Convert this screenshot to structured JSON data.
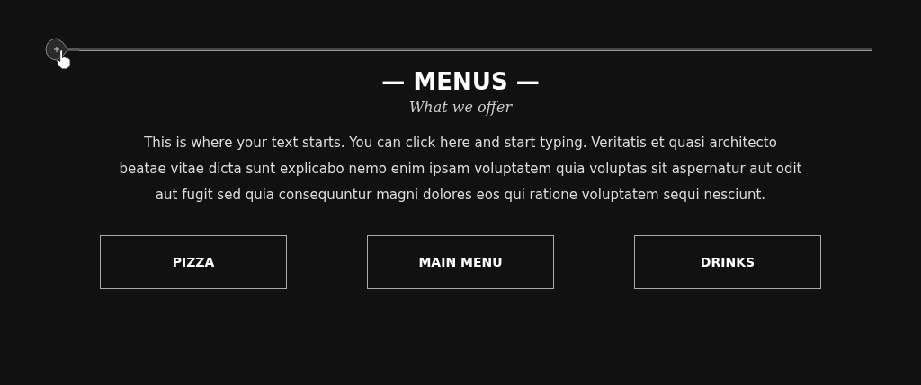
{
  "title": "— MENUS —",
  "subtitle": "What we offer",
  "body": "This is where your text starts. You can click here and start typing. Veritatis et quasi architecto beatae vitae dicta sunt explicabo nemo enim ipsam voluptatem quia voluptas sit aspernatur aut odit aut fugit sed quia consequuntur magni dolores eos qui ratione voluptatem sequi nesciunt.",
  "buttons": [
    "PIZZA",
    "MAIN MENU",
    "DRINKS"
  ]
}
